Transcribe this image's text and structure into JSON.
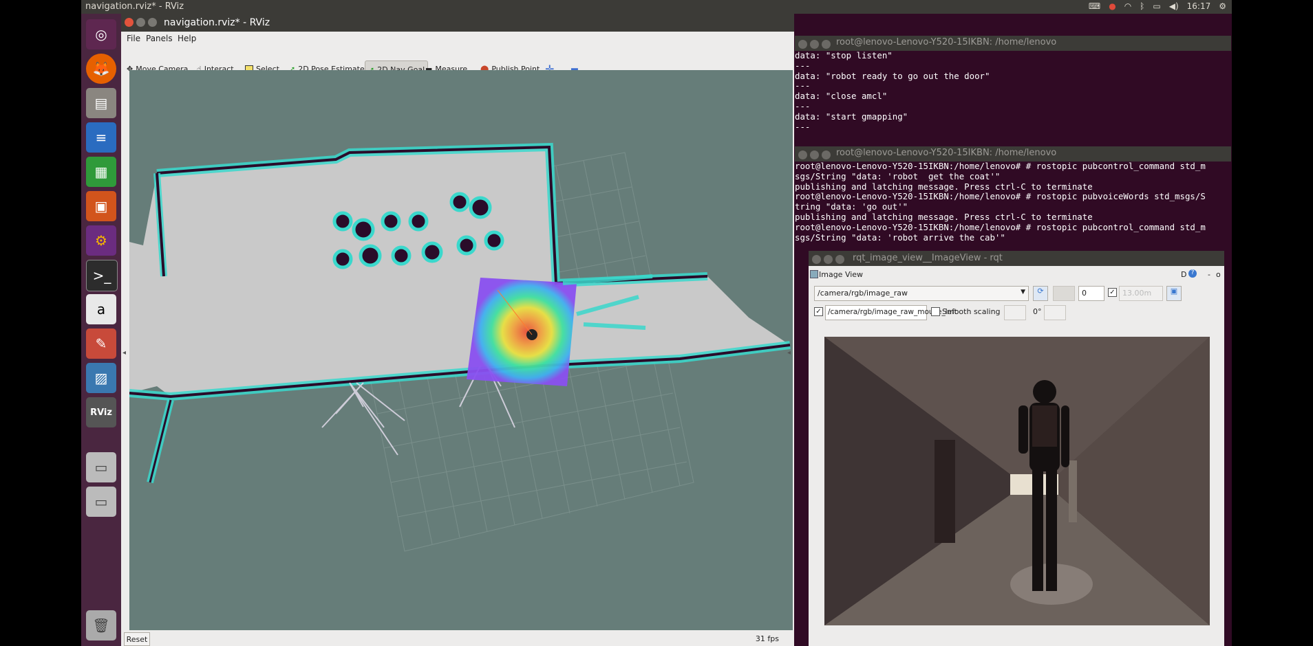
{
  "top_panel": {
    "title": "navigation.rviz* - RViz",
    "clock": "16:17"
  },
  "launcher": {
    "items": [
      "ubuntu-logo-icon",
      "firefox-icon",
      "files-icon",
      "writer-icon",
      "calc-icon",
      "impress-icon",
      "ubuntu-software-icon",
      "terminal-icon",
      "amazon-icon",
      "system-settings-icon",
      "image-viewer-icon",
      "rviz-icon",
      "drive-icon",
      "drive-icon",
      "trash-icon"
    ],
    "rviz_label": "RViz"
  },
  "rviz": {
    "window_title": "navigation.rviz* - RViz",
    "menu": [
      "File",
      "Panels",
      "Help"
    ],
    "tools": [
      "Move Camera",
      "Interact",
      "Select",
      "2D Pose Estimate",
      "2D Nav Goal",
      "Measure",
      "Publish Point"
    ],
    "active_tool": "2D Nav Goal",
    "reset_label": "Reset",
    "fps": "31 fps"
  },
  "terminal1": {
    "title": "root@lenovo-Lenovo-Y520-15IKBN: /home/lenovo",
    "lines": [
      "data: \"stop listen\"",
      "---",
      "data: \"robot ready to go out the door\"",
      "---",
      "data: \"close amcl\"",
      "---",
      "data: \"start gmapping\"",
      "---"
    ]
  },
  "terminal2": {
    "title": "root@lenovo-Lenovo-Y520-15IKBN: /home/lenovo",
    "lines": [
      "root@lenovo-Lenovo-Y520-15IKBN:/home/lenovo# # rostopic pubcontrol_command std_m",
      "sgs/String \"data: 'robot  get the coat'\"",
      "publishing and latching message. Press ctrl-C to terminate",
      "root@lenovo-Lenovo-Y520-15IKBN:/home/lenovo# # rostopic pubvoiceWords std_msgs/S",
      "tring \"data: 'go out'\"",
      "publishing and latching message. Press ctrl-C to terminate",
      "root@lenovo-Lenovo-Y520-15IKBN:/home/lenovo# # rostopic pubcontrol_command std_m",
      "sgs/String \"data: 'robot arrive the cab'\""
    ]
  },
  "rqt": {
    "window_title": "rqt_image_view__ImageView - rqt",
    "panel_title": "Image View",
    "panel_controls": "D",
    "topic": "/camera/rgb/image_raw",
    "spin_value": "0",
    "range_placeholder": "13.00m",
    "mouse_topic": "/camera/rgb/image_raw_mouse_left",
    "smooth_scaling_label": "Smooth scaling",
    "rotation": "0°"
  }
}
